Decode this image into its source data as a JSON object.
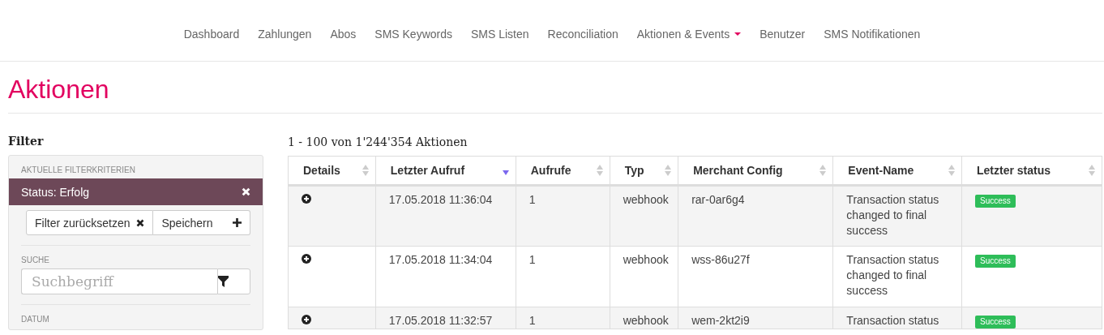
{
  "nav": {
    "items": [
      {
        "label": "Dashboard",
        "dropdown": false
      },
      {
        "label": "Zahlungen",
        "dropdown": false
      },
      {
        "label": "Abos",
        "dropdown": false
      },
      {
        "label": "SMS Keywords",
        "dropdown": false
      },
      {
        "label": "SMS Listen",
        "dropdown": false
      },
      {
        "label": "Reconciliation",
        "dropdown": false
      },
      {
        "label": "Aktionen & Events",
        "dropdown": true
      },
      {
        "label": "Benutzer",
        "dropdown": false
      },
      {
        "label": "SMS Notifikationen",
        "dropdown": false
      }
    ]
  },
  "page_title": "Aktionen",
  "filter": {
    "heading": "Filter",
    "current_label": "AKTUELLE FILTERKRITERIEN",
    "active_filter": "Status: Erfolg",
    "reset_button": "Filter zurücksetzen",
    "save_button": "Speichern",
    "search_label": "SUCHE",
    "search_placeholder": "Suchbegriff",
    "date_label": "DATUM"
  },
  "table": {
    "summary": "1 - 100 von 1'244'354 Aktionen",
    "columns": [
      {
        "label": "Details",
        "sorted": false
      },
      {
        "label": "Letzter Aufruf",
        "sorted": true
      },
      {
        "label": "Aufrufe",
        "sorted": false
      },
      {
        "label": "Typ",
        "sorted": false
      },
      {
        "label": "Merchant Config",
        "sorted": false
      },
      {
        "label": "Event-Name",
        "sorted": false
      },
      {
        "label": "Letzter status",
        "sorted": false
      }
    ],
    "rows": [
      {
        "last_call": "17.05.2018 11:36:04",
        "calls": "1",
        "type": "webhook",
        "merchant_config": "rar-0ar6g4",
        "event_name": "Transaction status changed to final success",
        "status": "Success"
      },
      {
        "last_call": "17.05.2018 11:34:04",
        "calls": "1",
        "type": "webhook",
        "merchant_config": "wss-86u27f",
        "event_name": "Transaction status changed to final success",
        "status": "Success"
      },
      {
        "last_call": "17.05.2018 11:32:57",
        "calls": "1",
        "type": "webhook",
        "merchant_config": "wem-2kt2i9",
        "event_name": "Transaction status",
        "status": "Success"
      }
    ]
  }
}
